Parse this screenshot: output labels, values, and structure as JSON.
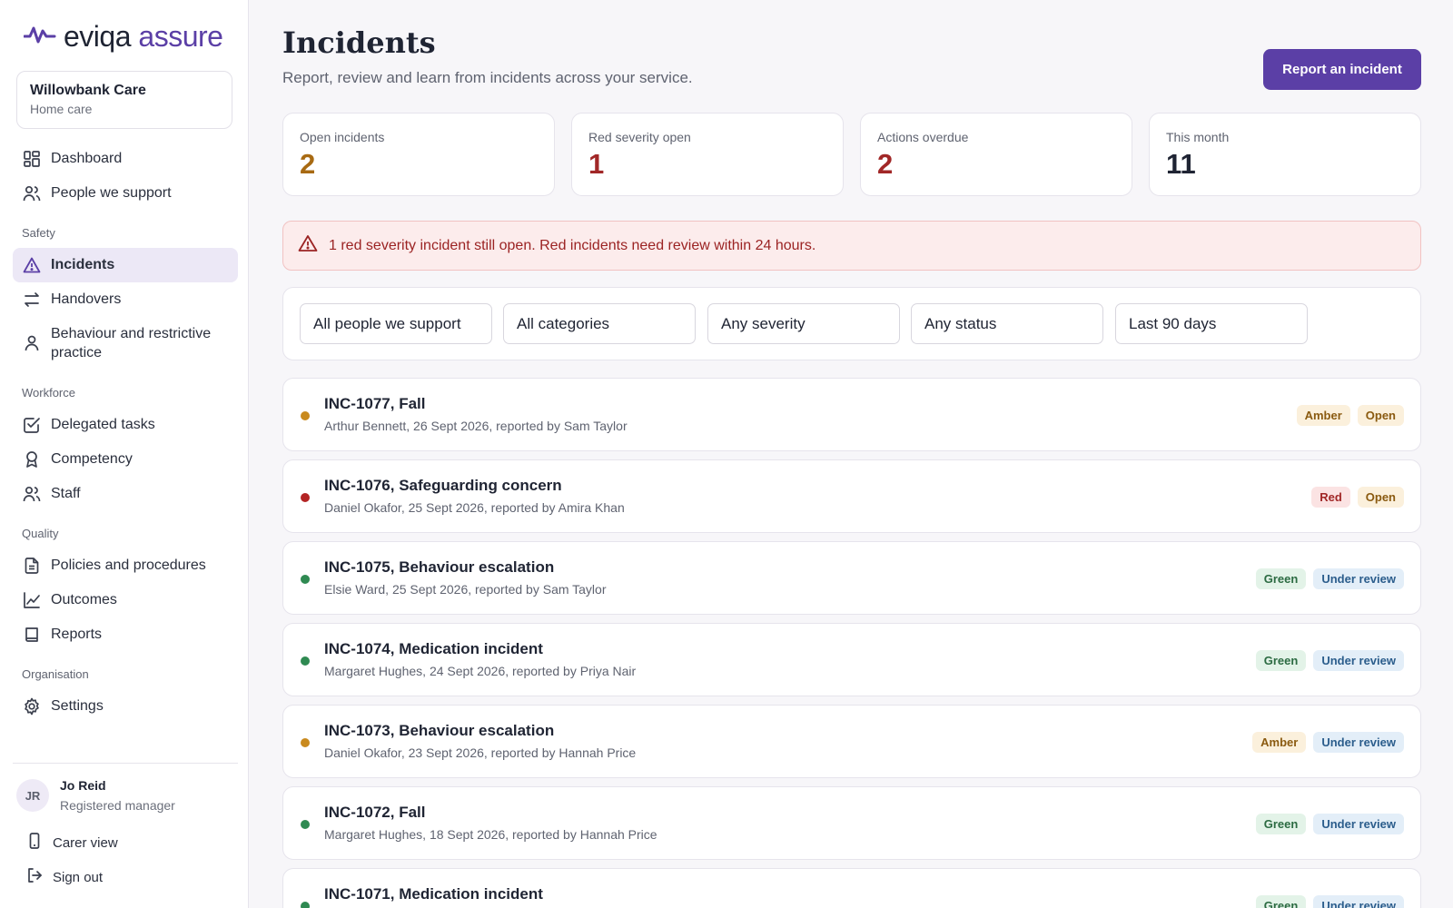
{
  "brand": {
    "name_part1": "eviqa",
    "name_part2": "assure",
    "accent": "#5b3fa6"
  },
  "org": {
    "name": "Willowbank Care",
    "type": "Home care"
  },
  "nav": {
    "dashboard": "Dashboard",
    "people": "People we support",
    "section_safety": "Safety",
    "incidents": "Incidents",
    "handovers": "Handovers",
    "behaviour": "Behaviour and restrictive practice",
    "section_workforce": "Workforce",
    "delegated": "Delegated tasks",
    "competency": "Competency",
    "staff": "Staff",
    "section_quality": "Quality",
    "policies": "Policies and procedures",
    "outcomes": "Outcomes",
    "reports": "Reports",
    "section_org": "Organisation",
    "settings": "Settings"
  },
  "user": {
    "initials": "JR",
    "name": "Jo Reid",
    "role": "Registered manager"
  },
  "footer": {
    "carer_view": "Carer view",
    "sign_out": "Sign out"
  },
  "page": {
    "title": "Incidents",
    "subtitle": "Report, review and learn from incidents across your service.",
    "report_button": "Report an incident"
  },
  "stats": [
    {
      "label": "Open incidents",
      "value": "2",
      "color": "#a86a12"
    },
    {
      "label": "Red severity open",
      "value": "1",
      "color": "#a12727"
    },
    {
      "label": "Actions overdue",
      "value": "2",
      "color": "#a12727"
    },
    {
      "label": "This month",
      "value": "11",
      "color": "#1f2433"
    }
  ],
  "alert": {
    "text": "1 red severity incident still open. Red incidents need review within 24 hours."
  },
  "filters": [
    "All people we support",
    "All categories",
    "Any severity",
    "Any status",
    "Last 90 days"
  ],
  "incidents": [
    {
      "title": "INC-1077, Fall",
      "meta": "Arthur Bennett, 26 Sept 2026, reported by Sam Taylor",
      "severity": "Amber",
      "status": "Open",
      "dot_color": "#c98a1e"
    },
    {
      "title": "INC-1076, Safeguarding concern",
      "meta": "Daniel Okafor, 25 Sept 2026, reported by Amira Khan",
      "severity": "Red",
      "status": "Open",
      "dot_color": "#b32424"
    },
    {
      "title": "INC-1075, Behaviour escalation",
      "meta": "Elsie Ward, 25 Sept 2026, reported by Sam Taylor",
      "severity": "Green",
      "status": "Under review",
      "dot_color": "#2f8a52"
    },
    {
      "title": "INC-1074, Medication incident",
      "meta": "Margaret Hughes, 24 Sept 2026, reported by Priya Nair",
      "severity": "Green",
      "status": "Under review",
      "dot_color": "#2f8a52"
    },
    {
      "title": "INC-1073, Behaviour escalation",
      "meta": "Daniel Okafor, 23 Sept 2026, reported by Hannah Price",
      "severity": "Amber",
      "status": "Under review",
      "dot_color": "#c98a1e"
    },
    {
      "title": "INC-1072, Fall",
      "meta": "Margaret Hughes, 18 Sept 2026, reported by Hannah Price",
      "severity": "Green",
      "status": "Under review",
      "dot_color": "#2f8a52"
    },
    {
      "title": "INC-1071, Medication incident",
      "meta": "",
      "severity": "Green",
      "status": "Under review",
      "dot_color": "#2f8a52"
    }
  ]
}
